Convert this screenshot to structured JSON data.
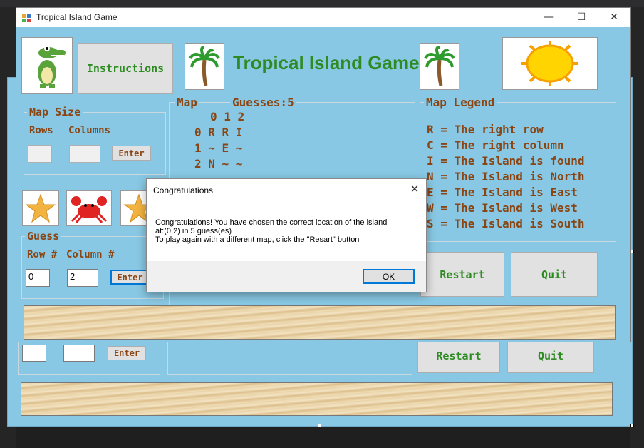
{
  "window": {
    "title": "Tropical Island Game",
    "minimize_glyph": "—",
    "maximize_glyph": "☐",
    "close_glyph": "✕"
  },
  "header": {
    "instructions_label": "Instructions",
    "game_title": "Tropical Island Game!"
  },
  "map_size": {
    "group_label": "Map Size",
    "rows_label": "Rows",
    "columns_label": "Columns",
    "rows_value": "",
    "columns_value": "",
    "enter_label": "Enter"
  },
  "map": {
    "label": "Map",
    "guesses_label": "Guesses:5",
    "header_row": "0 1 2",
    "rows": [
      "0 R R I",
      "1 ~ E ~",
      "2 N ~ ~"
    ]
  },
  "legend": {
    "title": "Map Legend",
    "lines": [
      "R = The right row",
      "C = The right column",
      "I = The Island is found",
      "N = The Island is North",
      "E = The Island is East",
      "W = The Island is West",
      "S = The Island is South"
    ]
  },
  "guess": {
    "group_label": "Guess",
    "row_label": "Row #",
    "column_label": "Column #",
    "row_value": "0",
    "column_value": "2",
    "enter_label": "Enter"
  },
  "actions": {
    "restart_label": "Restart",
    "quit_label": "Quit"
  },
  "designer": {
    "enter_label": "Enter",
    "restart_label": "Restart",
    "quit_label": "Quit"
  },
  "dialog": {
    "title": "Congratulations",
    "close_glyph": "✕",
    "message_line1": "Congratulations! You have chosen the correct location of the island",
    "message_line2": "at:(0,2) in 5 guess(es)",
    "message_line3": "To play again with a different map, click the \"Resart\" button",
    "ok_label": "OK"
  },
  "colors": {
    "form_background": "#88c8e4",
    "title_green": "#2e8b22",
    "label_brown": "#8b4513",
    "accent_blue": "#0078d7"
  }
}
